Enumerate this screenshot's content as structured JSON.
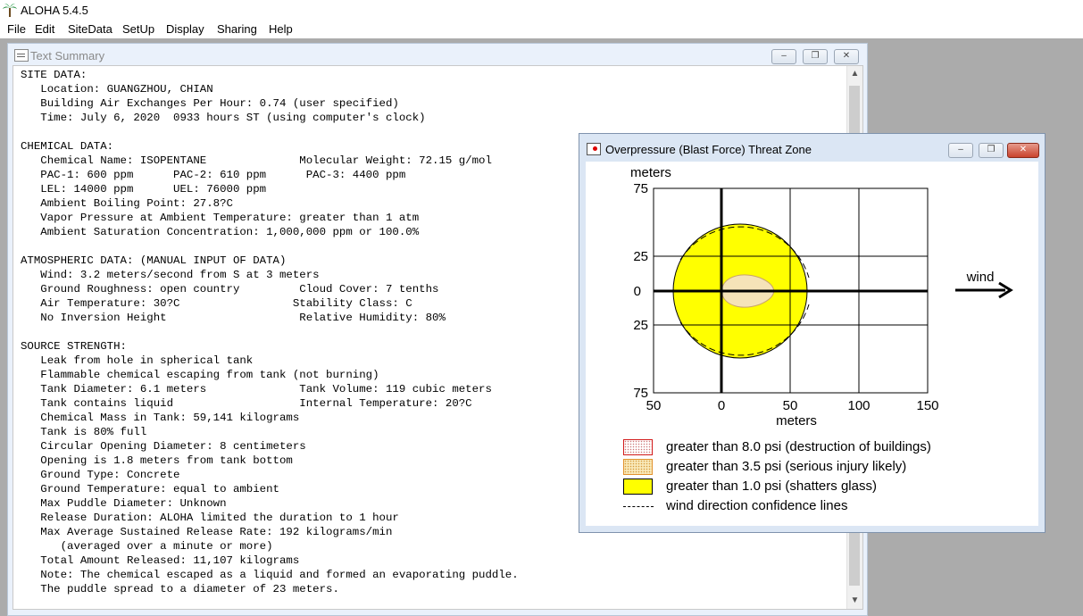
{
  "app": {
    "title": "ALOHA 5.4.5"
  },
  "menu": [
    "File",
    "Edit",
    "SiteData",
    "SetUp",
    "Display",
    "Sharing",
    "Help"
  ],
  "text_summary": {
    "title": "Text Summary",
    "lines": [
      "SITE DATA:",
      "   Location: GUANGZHOU, CHIAN",
      "   Building Air Exchanges Per Hour: 0.74 (user specified)",
      "   Time: July 6, 2020  0933 hours ST (using computer's clock)",
      "",
      "CHEMICAL DATA:",
      "   Chemical Name: ISOPENTANE              Molecular Weight: 72.15 g/mol",
      "   PAC-1: 600 ppm      PAC-2: 610 ppm      PAC-3: 4400 ppm",
      "   LEL: 14000 ppm      UEL: 76000 ppm",
      "   Ambient Boiling Point: 27.8?C",
      "   Vapor Pressure at Ambient Temperature: greater than 1 atm",
      "   Ambient Saturation Concentration: 1,000,000 ppm or 100.0%",
      "",
      "ATMOSPHERIC DATA: (MANUAL INPUT OF DATA)",
      "   Wind: 3.2 meters/second from S at 3 meters",
      "   Ground Roughness: open country         Cloud Cover: 7 tenths",
      "   Air Temperature: 30?C                 Stability Class: C",
      "   No Inversion Height                    Relative Humidity: 80%",
      "",
      "SOURCE STRENGTH:",
      "   Leak from hole in spherical tank",
      "   Flammable chemical escaping from tank (not burning)",
      "   Tank Diameter: 6.1 meters              Tank Volume: 119 cubic meters",
      "   Tank contains liquid                   Internal Temperature: 20?C",
      "   Chemical Mass in Tank: 59,141 kilograms",
      "   Tank is 80% full",
      "   Circular Opening Diameter: 8 centimeters",
      "   Opening is 1.8 meters from tank bottom",
      "   Ground Type: Concrete",
      "   Ground Temperature: equal to ambient",
      "   Max Puddle Diameter: Unknown",
      "   Release Duration: ALOHA limited the duration to 1 hour",
      "   Max Average Sustained Release Rate: 192 kilograms/min",
      "      (averaged over a minute or more)",
      "   Total Amount Released: 11,107 kilograms",
      "   Note: The chemical escaped as a liquid and formed an evaporating puddle.",
      "   The puddle spread to a diameter of 23 meters."
    ]
  },
  "threat_zone": {
    "title": "Overpressure (Blast Force) Threat Zone",
    "x_label": "meters",
    "y_label": "meters",
    "wind_label": "wind",
    "x_ticks": [
      "50",
      "0",
      "50",
      "100",
      "150"
    ],
    "y_ticks": [
      "75",
      "25",
      "0",
      "25",
      "75"
    ],
    "legend": [
      {
        "swatch": "red-dotted",
        "text": "greater than 8.0 psi (destruction of buildings)"
      },
      {
        "swatch": "orange-dotted",
        "text": "greater than 3.5 psi (serious injury likely)"
      },
      {
        "swatch": "yellow",
        "text": "greater than 1.0 psi (shatters glass)"
      },
      {
        "swatch": "dashed-line",
        "text": "wind direction confidence lines"
      }
    ],
    "zones": {
      "yellow_radius_m": 62,
      "orange_extent_m": [
        0,
        37
      ],
      "center_offset_m": 12
    }
  }
}
